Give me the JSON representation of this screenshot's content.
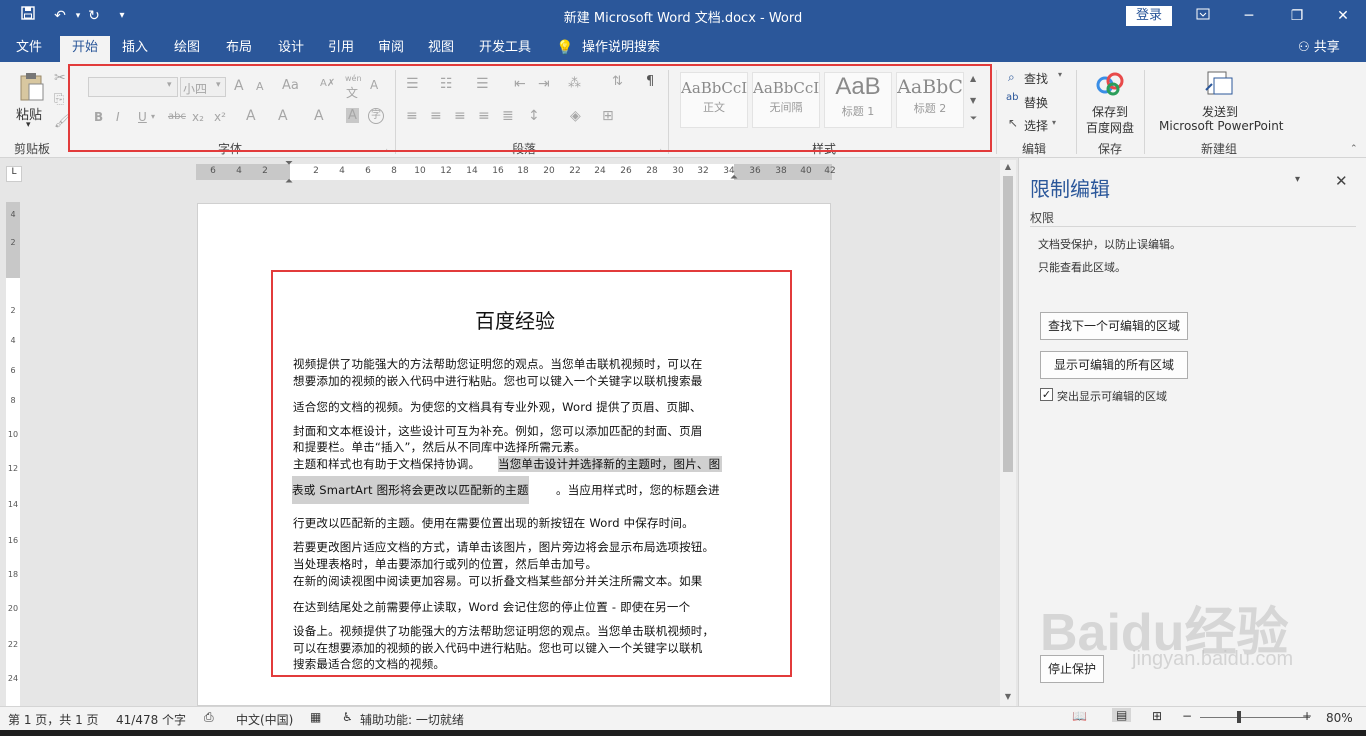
{
  "titlebar": {
    "title": "新建 Microsoft Word 文档.docx  -  Word",
    "login": "登录",
    "quick_access": {
      "save_icon": "save-icon",
      "undo_icon": "undo-icon",
      "redo_icon": "redo-icon",
      "customize_icon": "customize-icon"
    },
    "window_controls": {
      "ribbon_display": "ribbon-display-icon",
      "minimize": "minimize-icon",
      "restore": "restore-icon",
      "close": "close-icon"
    }
  },
  "tabs": [
    {
      "label": "文件"
    },
    {
      "label": "开始"
    },
    {
      "label": "插入"
    },
    {
      "label": "绘图"
    },
    {
      "label": "布局"
    },
    {
      "label": "设计"
    },
    {
      "label": "引用"
    },
    {
      "label": "审阅"
    },
    {
      "label": "视图"
    },
    {
      "label": "开发工具"
    }
  ],
  "active_tab": "开始",
  "tell_me": "操作说明搜索",
  "share": "共享",
  "ribbon": {
    "clipboard": {
      "paste": "粘贴",
      "label": "剪贴板"
    },
    "font": {
      "label": "字体",
      "size_placeholder": "小四",
      "grow": "A",
      "shrink": "A",
      "case": "Aa",
      "phonetic": "wén",
      "bold": "B",
      "italic": "I",
      "underline": "U",
      "strike": "abc",
      "sub": "x₂",
      "sup": "x²",
      "text_effects": "A",
      "highlight": "A",
      "font_color": "A",
      "char_shading": "A",
      "enclose": "字"
    },
    "paragraph": {
      "label": "段落"
    },
    "styles": {
      "label": "样式",
      "items": [
        {
          "sample": "AaBbCcI",
          "name": "正文"
        },
        {
          "sample": "AaBbCcI",
          "name": "无间隔"
        },
        {
          "sample": "AaB",
          "name": "标题 1"
        },
        {
          "sample": "AaBbC",
          "name": "标题 2"
        }
      ]
    },
    "editing": {
      "find": "查找",
      "replace": "替换",
      "select": "选择",
      "label": "编辑"
    },
    "save_group": {
      "line1": "保存到",
      "line2": "百度网盘",
      "label": "保存"
    },
    "new_group": {
      "line1": "发送到",
      "line2": "Microsoft PowerPoint",
      "label": "新建组"
    }
  },
  "ruler": {
    "h_ticks": [
      "6",
      "4",
      "2",
      "2",
      "4",
      "6",
      "8",
      "10",
      "12",
      "14",
      "16",
      "18",
      "20",
      "22",
      "24",
      "26",
      "28",
      "30",
      "32",
      "34",
      "36",
      "38",
      "40",
      "42"
    ],
    "v_ticks": [
      "4",
      "2",
      "2",
      "4",
      "6",
      "8",
      "10",
      "12",
      "14",
      "16",
      "18",
      "20",
      "22",
      "24"
    ]
  },
  "document": {
    "title": "百度经验",
    "lines": [
      "视频提供了功能强大的方法帮助您证明您的观点。当您单击联机视频时，可以在",
      "想要添加的视频的嵌入代码中进行粘贴。您也可以键入一个关键字以联机搜索最",
      "适合您的文档的视频。为使您的文档具有专业外观，Word 提供了页眉、页脚、",
      "封面和文本框设计，这些设计可互为补充。例如，您可以添加匹配的封面、页眉",
      "和提要栏。单击“插入”，然后从不同库中选择所需元素。",
      "主题和样式也有助于文档保持协调。",
      "当您单击设计并选择新的主题时，图片、图",
      "表或 SmartArt 图形将会更改以匹配新的主题",
      "。当应用样式时，您的标题会进",
      "行更改以匹配新的主题。使用在需要位置出现的新按钮在 Word 中保存时间。",
      "若要更改图片适应文档的方式，请单击该图片，图片旁边将会显示布局选项按钮。",
      "当处理表格时，单击要添加行或列的位置，然后单击加号。",
      "在新的阅读视图中阅读更加容易。可以折叠文档某些部分并关注所需文本。如果",
      "在达到结尾处之前需要停止读取，Word 会记住您的停止位置 - 即使在另一个",
      "设备上。视频提供了功能强大的方法帮助您证明您的观点。当您单击联机视频时，",
      "可以在想要添加的视频的嵌入代码中进行粘贴。您也可以键入一个关键字以联机",
      "搜索最适合您的文档的视频。"
    ]
  },
  "task_pane": {
    "title": "限制编辑",
    "section": "权限",
    "info_line1": "文档受保护，以防止误编辑。",
    "info_line2": "只能查看此区域。",
    "find_next": "查找下一个可编辑的区域",
    "show_all": "显示可编辑的所有区域",
    "highlight_label": "突出显示可编辑的区域",
    "highlight_checked": true,
    "stop_protect": "停止保护"
  },
  "statusbar": {
    "page": "第 1 页，共 1 页",
    "words": "41/478 个字",
    "language": "中文(中国)",
    "accessibility": "辅助功能: 一切就绪",
    "zoom": "80%"
  },
  "watermark": {
    "brand": "Baidu经验",
    "url": "jingyan.baidu.com"
  },
  "colors": {
    "accent": "#2b579a",
    "annotation": "#e23b3b"
  }
}
